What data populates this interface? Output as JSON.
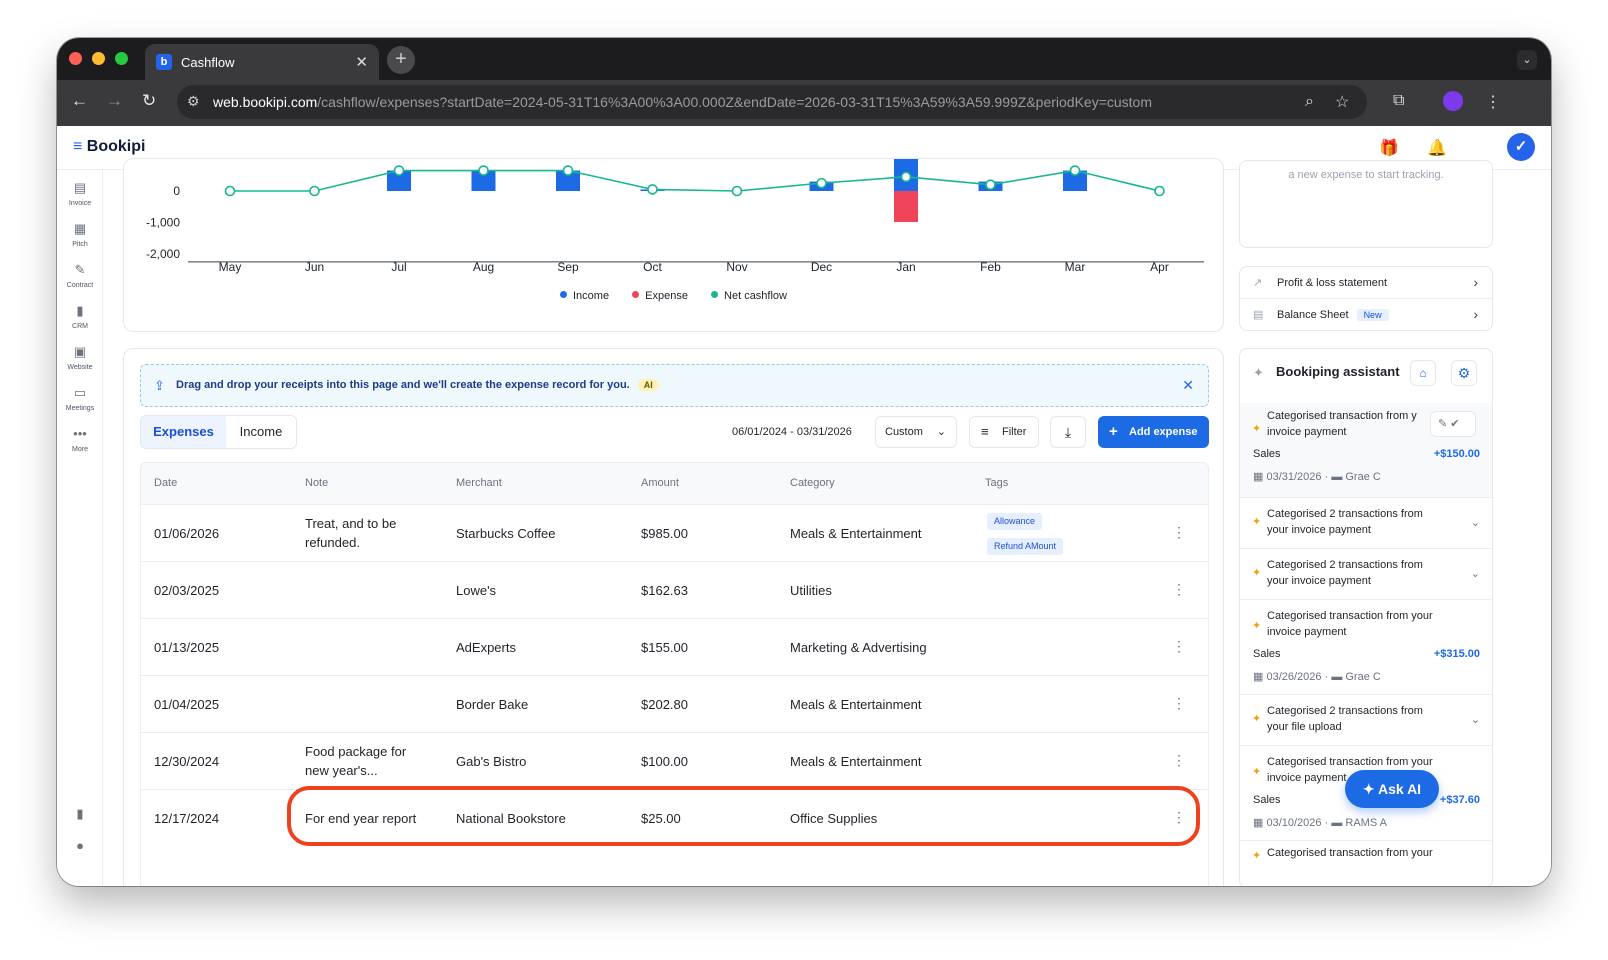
{
  "browser": {
    "tab_title": "Cashflow",
    "url_host": "web.bookipi.com",
    "url_path": "/cashflow/expenses?startDate=2024-05-31T16%3A00%3A00.000Z&endDate=2026-03-31T15%3A59%3A59.999Z&periodKey=custom"
  },
  "app": {
    "brand": "Bookipi"
  },
  "sidenav": [
    {
      "label": "Invoice",
      "icon": "invoice-icon"
    },
    {
      "label": "Pitch",
      "icon": "pitch-icon"
    },
    {
      "label": "Contract",
      "icon": "contract-icon"
    },
    {
      "label": "CRM",
      "icon": "crm-icon"
    },
    {
      "label": "Website",
      "icon": "website-icon"
    },
    {
      "label": "Meetings",
      "icon": "meetings-icon"
    },
    {
      "label": "More",
      "icon": "more-icon"
    }
  ],
  "chart_data": {
    "type": "bar",
    "categories": [
      "May",
      "Jun",
      "Jul",
      "Aug",
      "Sep",
      "Oct",
      "Nov",
      "Dec",
      "Jan",
      "Feb",
      "Mar",
      "Apr"
    ],
    "y_tick_labels": [
      "0",
      "-1,000",
      "-2,000"
    ],
    "series": [
      {
        "name": "Income",
        "color": "#1d6ae5",
        "values": [
          0,
          0,
          650,
          650,
          650,
          50,
          0,
          300,
          1300,
          300,
          650,
          0
        ]
      },
      {
        "name": "Expense",
        "color": "#f0445a",
        "values": [
          0,
          0,
          0,
          0,
          0,
          0,
          0,
          0,
          -985,
          0,
          0,
          0
        ]
      },
      {
        "name": "Net cashflow",
        "color": "#17b890",
        "values": [
          0,
          0,
          650,
          650,
          650,
          50,
          0,
          250,
          450,
          200,
          650,
          0
        ]
      }
    ],
    "legend_position": "bottom-center"
  },
  "chart_labels": {
    "legend": [
      "Income",
      "Expense",
      "Net cashflow"
    ]
  },
  "expenses": {
    "banner_text": "Drag and drop your receipts into this page and we'll create the expense record for you.",
    "banner_badge": "AI",
    "tabs": [
      "Expenses",
      "Income"
    ],
    "date_range": "06/01/2024 - 03/31/2026",
    "period": "Custom",
    "filter_label": "Filter",
    "add_label": "Add expense",
    "columns": [
      "Date",
      "Note",
      "Merchant",
      "Amount",
      "Category",
      "Tags"
    ],
    "rows": [
      {
        "date": "01/06/2026",
        "note": [
          "Treat, and to be",
          "refunded."
        ],
        "merchant": "Starbucks Coffee",
        "amount": "$985.00",
        "category": "Meals & Entertainment",
        "tags": [
          "Allowance",
          "Refund AMount"
        ]
      },
      {
        "date": "02/03/2025",
        "note": [],
        "merchant": "Lowe's",
        "amount": "$162.63",
        "category": "Utilities",
        "tags": []
      },
      {
        "date": "01/13/2025",
        "note": [],
        "merchant": "AdExperts",
        "amount": "$155.00",
        "category": "Marketing & Advertising",
        "tags": []
      },
      {
        "date": "01/04/2025",
        "note": [],
        "merchant": "Border Bake",
        "amount": "$202.80",
        "category": "Meals & Entertainment",
        "tags": []
      },
      {
        "date": "12/30/2024",
        "note": [
          "Food package for",
          "new year's..."
        ],
        "merchant": "Gab's Bistro",
        "amount": "$100.00",
        "category": "Meals & Entertainment",
        "tags": []
      },
      {
        "date": "12/17/2024",
        "note": [
          "For end year report"
        ],
        "merchant": "National Bookstore",
        "amount": "$25.00",
        "category": "Office Supplies",
        "tags": []
      }
    ]
  },
  "right_panel": {
    "top_hint": "a new expense to start tracking.",
    "reports": [
      {
        "label": "Profit & loss statement",
        "badge": ""
      },
      {
        "label": "Balance Sheet",
        "badge": "New"
      }
    ],
    "assistant_title": "Bookiping assistant",
    "items": [
      {
        "title": [
          "Categorised transaction from y",
          "invoice payment"
        ],
        "sales": "Sales",
        "amount": "+$150.00",
        "date": "03/31/2026",
        "who": "Grae C"
      },
      {
        "title": [
          "Categorised 2 transactions from",
          "your invoice payment"
        ]
      },
      {
        "title": [
          "Categorised 2 transactions from",
          "your invoice payment"
        ]
      },
      {
        "title": [
          "Categorised transaction from your",
          "invoice payment"
        ],
        "sales": "Sales",
        "amount": "+$315.00",
        "date": "03/26/2026",
        "who": "Grae C"
      },
      {
        "title": [
          "Categorised 2 transactions from",
          "your file upload"
        ]
      },
      {
        "title": [
          "Categorised transaction from your",
          "invoice payment"
        ],
        "sales": "Sales",
        "amount": "+$37.60",
        "date": "03/10/2026",
        "who": "RAMS A"
      },
      {
        "title": [
          "Categorised transaction from your",
          ""
        ]
      }
    ],
    "ask_ai": "Ask AI"
  }
}
